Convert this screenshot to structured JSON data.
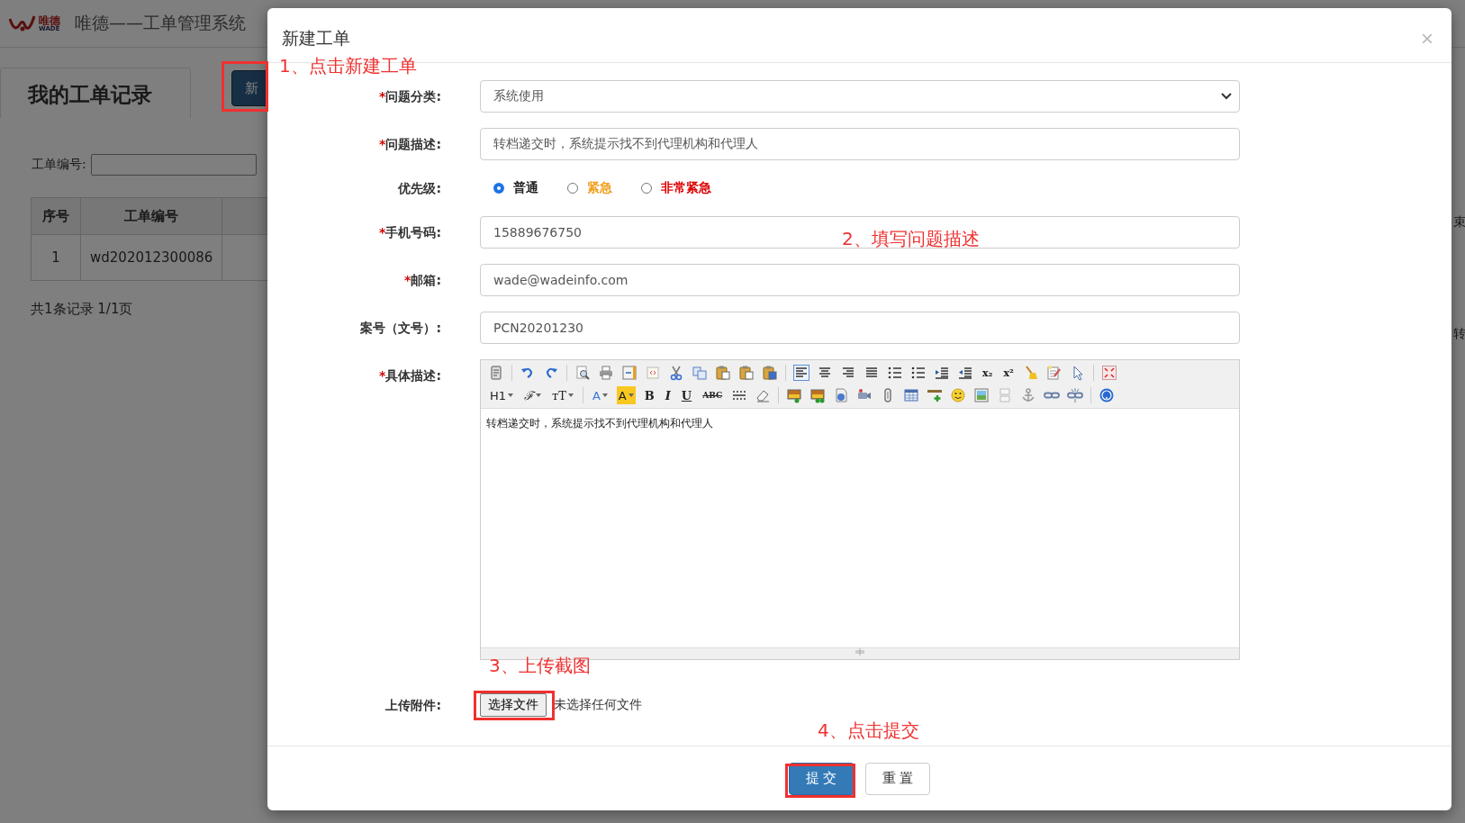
{
  "page": {
    "logo_text": "唯德",
    "logo_subtext": "WADE",
    "title": "唯德——工单管理系统",
    "tab": "我的工单记录",
    "new_button": "新",
    "search_label": "工单编号:",
    "table": {
      "columns": [
        "序号",
        "工单编号"
      ],
      "rows": [
        [
          "1",
          "wd202012300086"
        ]
      ]
    },
    "pagination": "共1条记录 1/1页",
    "right_column_header": "束",
    "right_cell": "转"
  },
  "modal": {
    "title": "新建工单",
    "close": "×",
    "fields": [
      {
        "kind": "select",
        "mark": "*",
        "label": "问题分类:",
        "value": "系统使用"
      },
      {
        "kind": "text",
        "mark": "*",
        "label": "问题描述:",
        "value": "转档递交时，系统提示找不到代理机构和代理人"
      },
      {
        "kind": "radio",
        "label": "优先级:",
        "options": [
          {
            "label": "普通",
            "selected": true,
            "color": "#222222"
          },
          {
            "label": "紧急",
            "selected": false,
            "color": "#f0a020"
          },
          {
            "label": "非常紧急",
            "selected": false,
            "color": "#dd0000"
          }
        ]
      },
      {
        "kind": "text",
        "mark": "*",
        "label": "手机号码:",
        "value": "15889676750"
      },
      {
        "kind": "text",
        "mark": "*",
        "label": "邮箱:",
        "value": "wade@wadeinfo.com"
      },
      {
        "kind": "text",
        "label": "案号（文号）:",
        "value": "PCN20201230"
      },
      {
        "kind": "editor",
        "mark": "*",
        "label": "具体描述:",
        "toolbar_labels": [
          "x₂",
          "x²",
          "H1",
          "ℱ",
          "ᴛT",
          "A",
          "A",
          "B",
          "I",
          "U",
          "ABC"
        ],
        "content": "转档递交时，系统提示找不到代理机构和代理人"
      },
      {
        "kind": "file",
        "label": "上传附件:",
        "button": "选择文件",
        "status": "未选择任何文件"
      }
    ],
    "buttons": [
      {
        "label": "提 交",
        "kind": "primary"
      },
      {
        "label": "重 置",
        "kind": "default"
      }
    ]
  },
  "annotations": [
    {
      "text": "1、点击新建工单"
    },
    {
      "text": "2、填写问题描述"
    },
    {
      "text": "3、上传截图"
    },
    {
      "text": "4、点击提交"
    }
  ]
}
